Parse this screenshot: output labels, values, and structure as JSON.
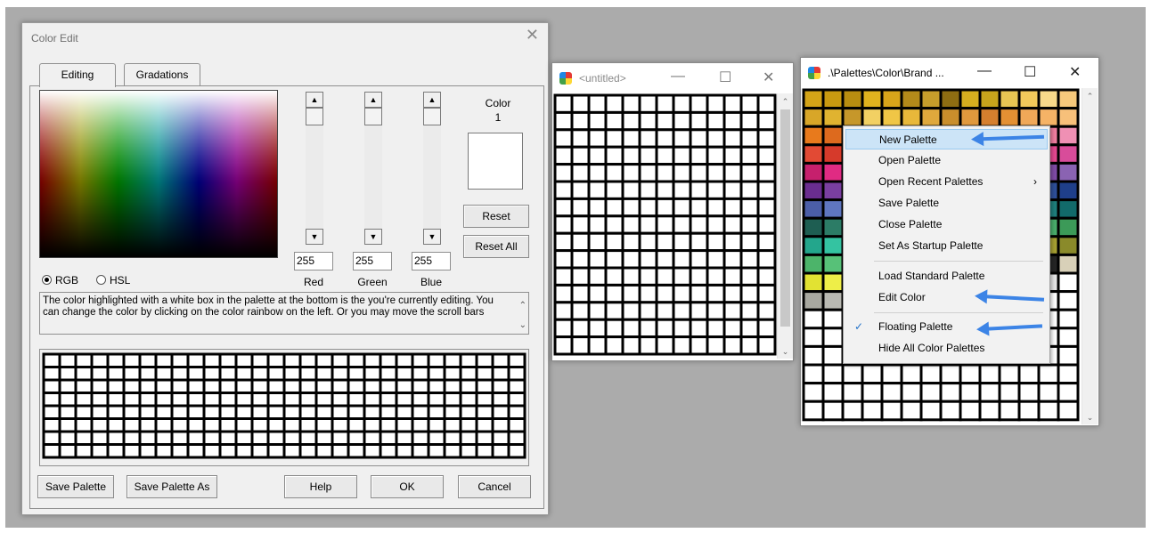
{
  "color_edit": {
    "title": "Color Edit",
    "close": "✕",
    "tabs": [
      "Editing",
      "Gradations"
    ],
    "channels": [
      {
        "label": "Red",
        "value": "255"
      },
      {
        "label": "Green",
        "value": "255"
      },
      {
        "label": "Blue",
        "value": "255"
      }
    ],
    "color_label": "Color",
    "color_index": "1",
    "reset": "Reset",
    "reset_all": "Reset All",
    "mode_rgb": "RGB",
    "mode_hsl": "HSL",
    "description": "The color highlighted with a white box in the palette at the bottom is the you're currently editing. You can change the color by clicking on the color rainbow on the left. Or you may move the scroll bars",
    "buttons": {
      "save_palette": "Save Palette",
      "save_palette_as": "Save Palette As",
      "help": "Help",
      "ok": "OK",
      "cancel": "Cancel"
    }
  },
  "untitled_window": {
    "title": "<untitled>",
    "minimize": "—",
    "maximize": "☐",
    "close": "✕"
  },
  "brand_window": {
    "title": ".\\Palettes\\Color\\Brand ...",
    "minimize": "—",
    "maximize": "☐",
    "close": "✕"
  },
  "context_menu": {
    "items": [
      {
        "label": "New Palette",
        "highlighted": true
      },
      {
        "label": "Open Palette"
      },
      {
        "label": "Open Recent Palettes",
        "submenu": true
      },
      {
        "label": "Save Palette"
      },
      {
        "label": "Close Palette"
      },
      {
        "label": "Set As Startup Palette"
      },
      {
        "label": "Load Standard Palette"
      },
      {
        "label": "Edit Color"
      },
      {
        "label": "Floating Palette",
        "checked": true
      },
      {
        "label": "Hide All Color Palettes"
      }
    ],
    "submenu_glyph": "›",
    "check_glyph": "✓"
  },
  "annotation_color": "#3c84e6",
  "brand_palette_colors": [
    [
      "#d4a417",
      "#c99a10",
      "#b88d10",
      "#e0b21e",
      "#d9a51a",
      "#b48a1a",
      "#c69d2b",
      "#8e6d12",
      "#d6ae1f",
      "#c7a41c",
      "#e7c553",
      "#f2c95b",
      "#f8d98a",
      "#f6c97c"
    ],
    [
      "#d8a628",
      "#e0b330",
      "#c6972a",
      "#f2d063",
      "#f0c646",
      "#e8b83a",
      "#dfa83c",
      "#c98e2c",
      "#e0993d",
      "#d57f2e",
      "#e39033",
      "#f0a858",
      "#f5b366",
      "#f7c07a"
    ],
    [
      "#e87a1c",
      "#dd6a1e",
      "#e9b17f",
      "#e35f23",
      "#e0561f",
      "#d9451b",
      "#ef7f3f",
      "#eb8c61",
      "#f29c70",
      "#f0a489",
      "#f09fa5",
      "#f2889b",
      "#f07ea0",
      "#ef90b4"
    ],
    [
      "#e24a34",
      "#d63a2b",
      "#f09a90",
      "#e8616b",
      "#e04a5a",
      "#e83c62",
      "#ed5c7a",
      "#d81e55",
      "#e04e8a",
      "#ed6aa0",
      "#f08fb6",
      "#ec5c9e",
      "#e44890",
      "#d84c9a"
    ],
    [
      "#c6206d",
      "#e02b83",
      "#f7c2dc",
      "#d2388f",
      "#c22a8a",
      "#b72d91",
      "#a23a99",
      "#8f3c9f",
      "#9b5ab0",
      "#b789c6",
      "#c8a4d6",
      "#a577bd",
      "#7f4ca6",
      "#8a63b2"
    ],
    [
      "#6a2d8f",
      "#7a3fa0",
      "#e9d7ef",
      "#4a3c92",
      "#3e3d9c",
      "#3b4fa8",
      "#2e5aa9",
      "#243f93",
      "#2c5fb1",
      "#5e86c8",
      "#89a8d8",
      "#3969b8",
      "#2e4f98",
      "#1f3f8a"
    ],
    [
      "#4b5ea8",
      "#5f76c0",
      "#c8d3ee",
      "#2b6ab0",
      "#1b84c4",
      "#1a96c9",
      "#2aa6c7",
      "#31a8b8",
      "#2db0b3",
      "#6fc5c6",
      "#a8dcd8",
      "#2e9c9a",
      "#1f7e7c",
      "#126a6a"
    ],
    [
      "#1e5e52",
      "#2c7c66",
      "#bfe5d9",
      "#26a57d",
      "#2dbb8b",
      "#47c59b",
      "#5ec8a5",
      "#77d1b1",
      "#8fdbb9",
      "#b2e6cc",
      "#cdeed9",
      "#73c58e",
      "#4aad6b",
      "#3c9a58"
    ],
    [
      "#23a68c",
      "#34c3a1",
      "#d5f2e9",
      "#5ccf76",
      "#6bd16b",
      "#80d45a",
      "#9fd94f",
      "#b8db45",
      "#c9d93e",
      "#d8dc48",
      "#e2e26a",
      "#c7c23a",
      "#a6a033",
      "#8a8a2a"
    ],
    [
      "#4cb46a",
      "#57c178",
      "#e3f5e4",
      "#9bd463",
      "#b8dc54",
      "#d0e04a",
      "#e3e24a",
      "#eee25d",
      "#f2e06b",
      "#f4e27f",
      "#f6e896",
      "#d8c24a",
      "#252525",
      "#d8d0b8"
    ],
    [
      "#e2e232",
      "#eeee48",
      "#f8f6a8",
      "#ece04e",
      "#f2d94a",
      "#eecb40",
      "#e8bd3a",
      "#d8ae36",
      "#c89e34",
      "#9f9f9f",
      "#b8b8b8",
      "#d0d0d0",
      "#e6e6e6",
      "#ffffff"
    ],
    [
      "#a8a8a0",
      "#b9b9b2",
      "#ffffff",
      "#ffffff",
      "#ffffff",
      "#ffffff",
      "#ffffff",
      "#ffffff",
      "#ffffff",
      "#ffffff",
      "#ffffff",
      "#ffffff",
      "#ffffff",
      "#ffffff"
    ]
  ]
}
